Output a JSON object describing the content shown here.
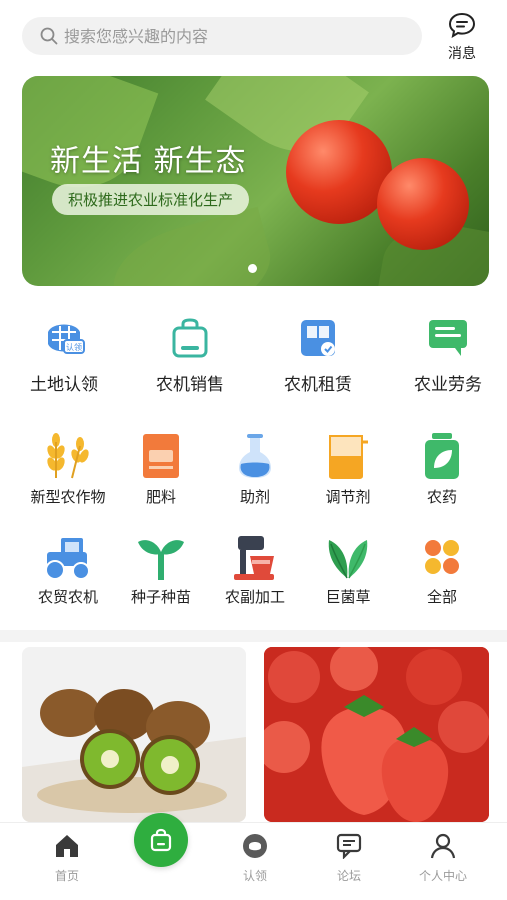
{
  "search": {
    "placeholder": "搜索您感兴趣的内容"
  },
  "header": {
    "message_label": "消息"
  },
  "banner": {
    "title": "新生活 新生态",
    "subtitle": "积极推进农业标准化生产"
  },
  "main_categories": [
    {
      "label": "土地认领",
      "icon": "land-claim-icon"
    },
    {
      "label": "农机销售",
      "icon": "shopping-bag-icon"
    },
    {
      "label": "农机租赁",
      "icon": "machinery-rent-icon"
    },
    {
      "label": "农业劳务",
      "icon": "labor-chat-icon"
    }
  ],
  "sub_categories_row1": [
    {
      "label": "新型农作物",
      "icon": "wheat-icon"
    },
    {
      "label": "肥料",
      "icon": "fertilizer-icon"
    },
    {
      "label": "助剂",
      "icon": "flask-icon"
    },
    {
      "label": "调节剂",
      "icon": "beaker-icon"
    },
    {
      "label": "农药",
      "icon": "pesticide-bottle-icon"
    }
  ],
  "sub_categories_row2": [
    {
      "label": "农贸农机",
      "icon": "tractor-icon"
    },
    {
      "label": "种子种苗",
      "icon": "seedling-icon"
    },
    {
      "label": "农副加工",
      "icon": "mixer-icon"
    },
    {
      "label": "巨菌草",
      "icon": "grass-leaves-icon"
    },
    {
      "label": "全部",
      "icon": "all-grid-icon"
    }
  ],
  "bottom_nav": [
    {
      "label": "首页",
      "icon": "home-icon"
    },
    {
      "label": "",
      "icon": "shopping-bag-icon"
    },
    {
      "label": "认领",
      "icon": "claim-icon"
    },
    {
      "label": "论坛",
      "icon": "forum-icon"
    },
    {
      "label": "个人中心",
      "icon": "user-icon"
    }
  ],
  "colors": {
    "brand_green": "#2fae3f",
    "nav_gray": "#9b9b9b",
    "blue": "#4a90e2"
  }
}
